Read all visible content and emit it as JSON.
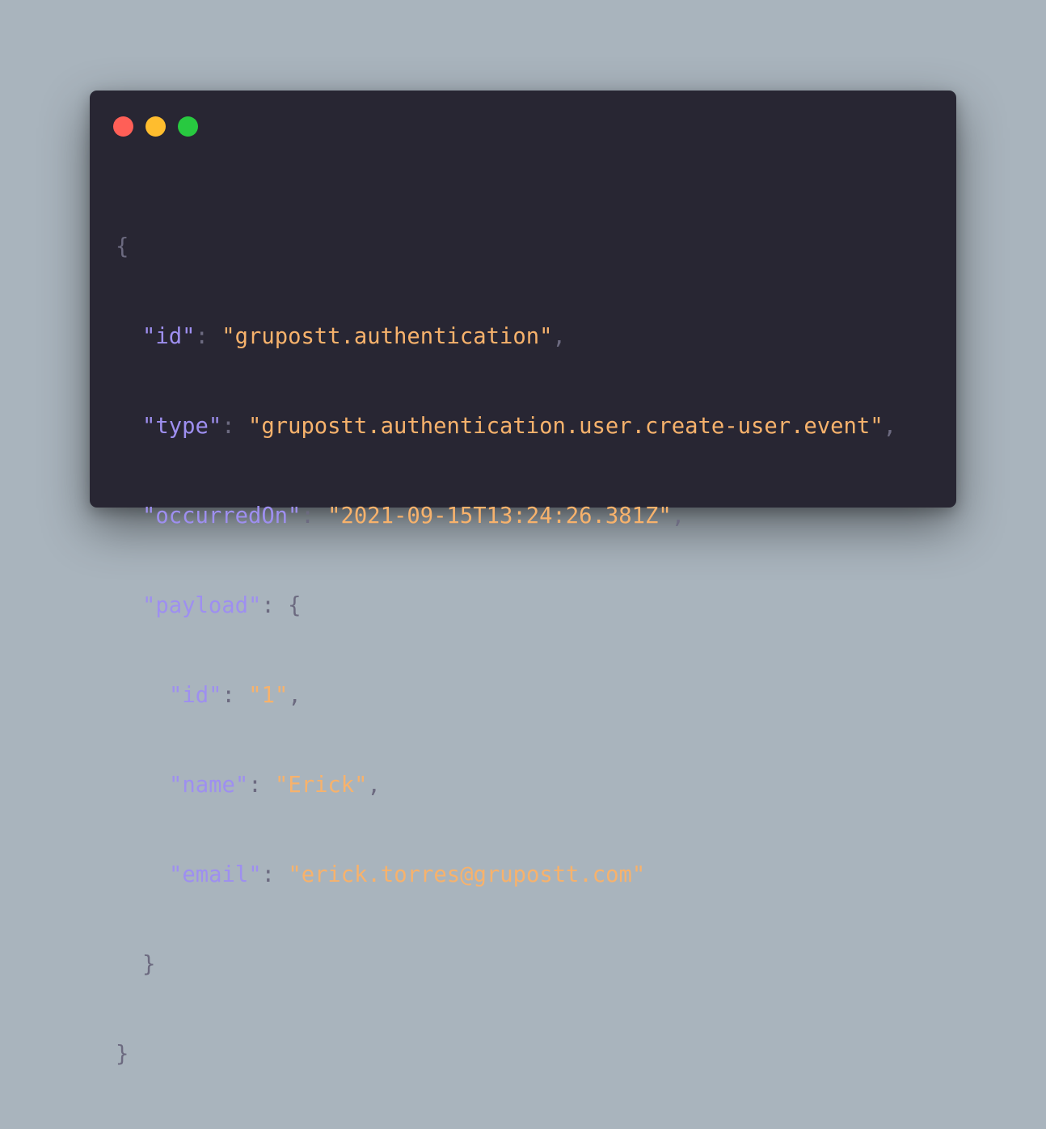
{
  "window": {
    "controls": [
      {
        "name": "close",
        "color": "#ff5f57"
      },
      {
        "name": "minimize",
        "color": "#ffbd2e"
      },
      {
        "name": "maximize",
        "color": "#28c940"
      }
    ]
  },
  "code": {
    "open_brace": "{",
    "id_key": "\"id\"",
    "id_value": "\"grupostt.authentication\"",
    "type_key": "\"type\"",
    "type_value": "\"grupostt.authentication.user.create-user.event\"",
    "occurred_key": "\"occurredOn\"",
    "occurred_value": "\"2021-09-15T13:24:26.381Z\"",
    "payload_key": "\"payload\"",
    "payload_open": "{",
    "payload_id_key": "\"id\"",
    "payload_id_value": "\"1\"",
    "payload_name_key": "\"name\"",
    "payload_name_value": "\"Erick\"",
    "payload_email_key": "\"email\"",
    "payload_email_value": "\"erick.torres@grupostt.com\"",
    "payload_close": "}",
    "close_brace": "}",
    "colon": ": ",
    "comma": ","
  }
}
